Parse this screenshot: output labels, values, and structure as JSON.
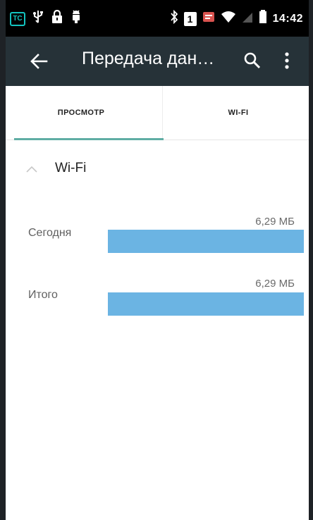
{
  "status_bar": {
    "app_badge": "TC",
    "sim_slot": "1",
    "time": "14:42",
    "icons": [
      "usb-icon",
      "lock-icon",
      "android-debug-icon",
      "bluetooth-icon",
      "sim-card-icon",
      "notification-icon",
      "wifi-icon",
      "no-signal-icon",
      "battery-icon"
    ]
  },
  "toolbar": {
    "title": "Передача дан…",
    "icons": [
      "back-arrow-icon",
      "search-icon",
      "more-vert-icon"
    ]
  },
  "tabs": [
    {
      "label": "ПРОСМОТР",
      "selected": true
    },
    {
      "label": "WI-FI",
      "selected": false
    }
  ],
  "section": {
    "title": "Wi-Fi",
    "icon": "chevron-up-icon"
  },
  "usage": {
    "today_label": "Сегодня",
    "today_value": "6,29 МБ",
    "today_fraction": 1.0,
    "total_label": "Итого",
    "total_value": "6,29 МБ",
    "total_fraction": 1.0
  },
  "colors": {
    "toolbar": "#263238",
    "tab_indicator": "#5fada4",
    "bar": "#6bb4e3",
    "app_badge": "#13c4c0"
  }
}
